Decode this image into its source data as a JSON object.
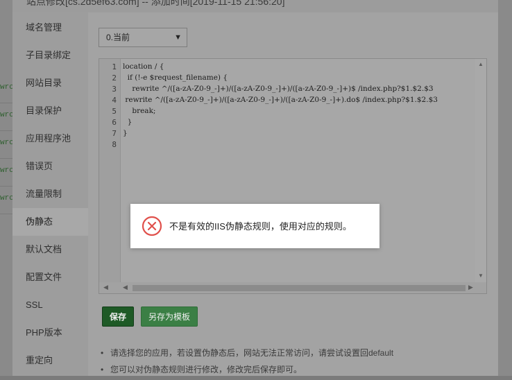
{
  "window": {
    "title": "站点修改[cs.2d5ef63.com] -- 添加时间[2019-11-15 21:56:20]"
  },
  "background": {
    "row_labels": [
      "wrc",
      "wrc",
      "wrc",
      "wrc",
      "wrc"
    ]
  },
  "sidebar": {
    "items": [
      {
        "label": "域名管理"
      },
      {
        "label": "子目录绑定"
      },
      {
        "label": "网站目录"
      },
      {
        "label": "目录保护"
      },
      {
        "label": "应用程序池"
      },
      {
        "label": "错误页"
      },
      {
        "label": "流量限制"
      },
      {
        "label": "伪静态"
      },
      {
        "label": "默认文档"
      },
      {
        "label": "配置文件"
      },
      {
        "label": "SSL"
      },
      {
        "label": "PHP版本"
      },
      {
        "label": "重定向"
      }
    ],
    "active": "伪静态"
  },
  "rewrite": {
    "template_select": "0.当前",
    "editor": {
      "line_numbers": [
        "1",
        "2",
        "3",
        "4",
        "5",
        "6",
        "7",
        "8"
      ],
      "lines": [
        "location / {",
        "  if (!-e $request_filename) {",
        "    rewrite ^/([a-zA-Z0-9_-]+)/([a-zA-Z0-9_-]+)/([a-zA-Z0-9_-]+)$ /index.php?$1.$2.$3",
        " rewrite ^/([a-zA-Z0-9_-]+)/([a-zA-Z0-9_-]+)/([a-zA-Z0-9_-]+).do$ /index.php?$1.$2.$3",
        "    break;",
        "  }",
        "}",
        ""
      ]
    },
    "save_label": "保存",
    "save_as_template_label": "另存为模板",
    "tips": [
      "请选择您的应用，若设置伪静态后，网站无法正常访问，请尝试设置回default",
      "您可以对伪静态规则进行修改，修改完后保存即可。"
    ]
  },
  "toast": {
    "message": "不是有效的IIS伪静态规则，使用对应的规则。",
    "icon": "error-circle-x-icon",
    "icon_color": "#e0504b"
  }
}
